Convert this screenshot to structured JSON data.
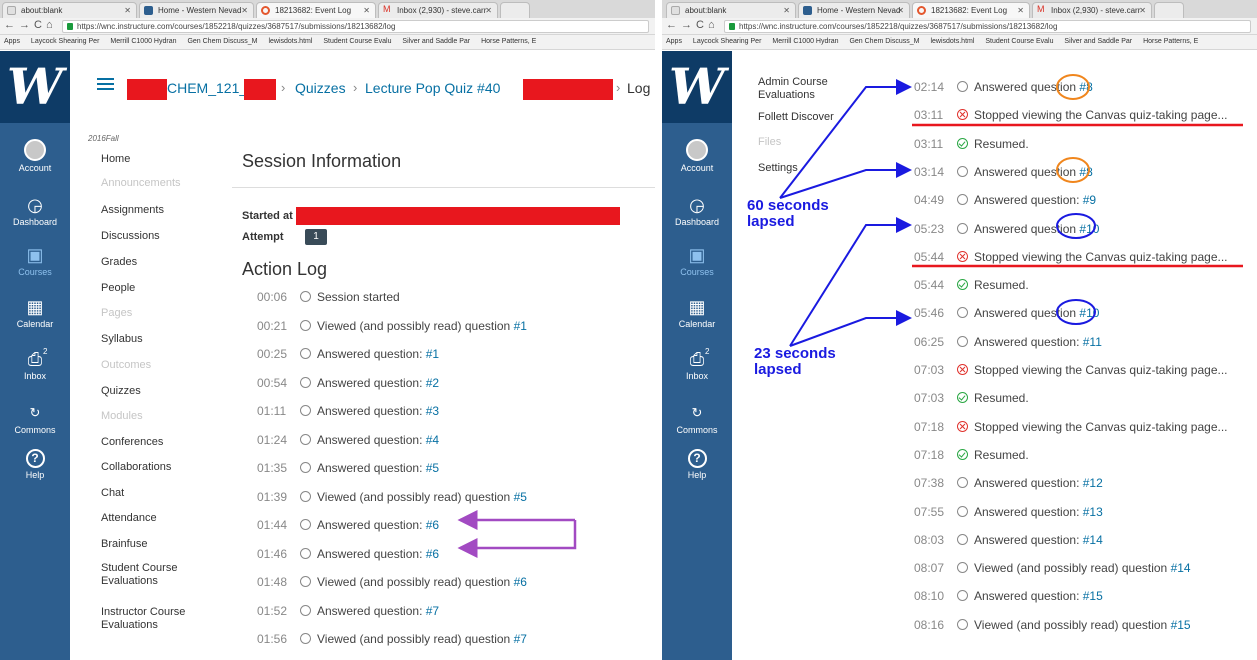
{
  "left": {
    "tabs": [
      {
        "label": "about:blank",
        "color": "#e0e0e0"
      },
      {
        "label": "Home - Western Nevad",
        "color": "#2d5e8e"
      },
      {
        "label": "18213682: Event Log",
        "color": "#e4572e"
      },
      {
        "label": "Inbox (2,930) - steve.carr",
        "color": "#d93025"
      }
    ],
    "url": "https://wnc.instructure.com/courses/1852218/quizzes/3687517/submissions/18213682/log",
    "bookmarks": [
      "Apps",
      "Laycock Shearing Per",
      "Merrill C1000 Hydran",
      "Gen Chem Discuss_M",
      "lewisdots.html",
      "Student Course Evalu",
      "Silver and Saddle Par",
      "Horse Patterns, E"
    ],
    "breadcrumb": {
      "course": "CHEM_121_",
      "quizzes": "Quizzes",
      "quiz": "Lecture Pop Quiz #40",
      "log": "Log",
      "sep": "›"
    },
    "term": "2016Fall",
    "course_nav": [
      {
        "label": "Home",
        "disabled": false
      },
      {
        "label": "Announcements",
        "disabled": true
      },
      {
        "label": "Assignments",
        "disabled": false
      },
      {
        "label": "Discussions",
        "disabled": false
      },
      {
        "label": "Grades",
        "disabled": false
      },
      {
        "label": "People",
        "disabled": false
      },
      {
        "label": "Pages",
        "disabled": true
      },
      {
        "label": "Syllabus",
        "disabled": false
      },
      {
        "label": "Outcomes",
        "disabled": true
      },
      {
        "label": "Quizzes",
        "disabled": false
      },
      {
        "label": "Modules",
        "disabled": true
      },
      {
        "label": "Conferences",
        "disabled": false
      },
      {
        "label": "Collaborations",
        "disabled": false
      },
      {
        "label": "Chat",
        "disabled": false
      },
      {
        "label": "Attendance",
        "disabled": false
      },
      {
        "label": "Brainfuse",
        "disabled": false
      },
      {
        "label": "Student Course\nEvaluations",
        "disabled": false
      },
      {
        "label": "Instructor Course\nEvaluations",
        "disabled": false
      }
    ],
    "session_title": "Session Information",
    "started_label": "Started at",
    "attempt_label": "Attempt",
    "attempt_value": "1",
    "action_log_title": "Action Log",
    "log": [
      {
        "time": "00:06",
        "status": "plain",
        "text": "Session started",
        "q": ""
      },
      {
        "time": "00:21",
        "status": "plain",
        "text": "Viewed (and possibly read) question ",
        "q": "#1"
      },
      {
        "time": "00:25",
        "status": "plain",
        "text": "Answered question: ",
        "q": "#1"
      },
      {
        "time": "00:54",
        "status": "plain",
        "text": "Answered question: ",
        "q": "#2"
      },
      {
        "time": "01:11",
        "status": "plain",
        "text": "Answered question: ",
        "q": "#3"
      },
      {
        "time": "01:24",
        "status": "plain",
        "text": "Answered question: ",
        "q": "#4"
      },
      {
        "time": "01:35",
        "status": "plain",
        "text": "Answered question: ",
        "q": "#5"
      },
      {
        "time": "01:39",
        "status": "plain",
        "text": "Viewed (and possibly read) question ",
        "q": "#5"
      },
      {
        "time": "01:44",
        "status": "plain",
        "text": "Answered question: ",
        "q": "#6"
      },
      {
        "time": "01:46",
        "status": "plain",
        "text": "Answered question: ",
        "q": "#6"
      },
      {
        "time": "01:48",
        "status": "plain",
        "text": "Viewed (and possibly read) question ",
        "q": "#6"
      },
      {
        "time": "01:52",
        "status": "plain",
        "text": "Answered question: ",
        "q": "#7"
      },
      {
        "time": "01:56",
        "status": "plain",
        "text": "Viewed (and possibly read) question ",
        "q": "#7"
      }
    ]
  },
  "right": {
    "tabs": [
      {
        "label": "about:blank",
        "color": "#e0e0e0"
      },
      {
        "label": "Home - Western Nevad",
        "color": "#2d5e8e"
      },
      {
        "label": "18213682: Event Log",
        "color": "#e4572e"
      },
      {
        "label": "Inbox (2,930) - steve.carr",
        "color": "#d93025"
      }
    ],
    "url": "https://wnc.instructure.com/courses/1852218/quizzes/3687517/submissions/18213682/log",
    "bookmarks": [
      "Apps",
      "Laycock Shearing Per",
      "Merrill C1000 Hydran",
      "Gen Chem Discuss_M",
      "lewisdots.html",
      "Student Course Evalu",
      "Silver and Saddle Par",
      "Horse Patterns, E"
    ],
    "course_nav": [
      {
        "label": "Admin Course\nEvaluations",
        "disabled": false
      },
      {
        "label": "Follett Discover",
        "disabled": false
      },
      {
        "label": "Files",
        "disabled": true
      },
      {
        "label": "Settings",
        "disabled": false
      }
    ],
    "annotations": {
      "first": "60 seconds\nlapsed",
      "second": "23 seconds\nlapsed"
    },
    "log": [
      {
        "time": "02:14",
        "status": "plain",
        "text": "Answered question ",
        "q": "#8"
      },
      {
        "time": "03:11",
        "status": "stop",
        "text": "Stopped viewing the Canvas quiz-taking page...",
        "q": ""
      },
      {
        "time": "03:11",
        "status": "ok",
        "text": "Resumed.",
        "q": ""
      },
      {
        "time": "03:14",
        "status": "plain",
        "text": "Answered question ",
        "q": "#8"
      },
      {
        "time": "04:49",
        "status": "plain",
        "text": "Answered question: ",
        "q": "#9"
      },
      {
        "time": "05:23",
        "status": "plain",
        "text": "Answered question ",
        "q": "#10"
      },
      {
        "time": "05:44",
        "status": "stop",
        "text": "Stopped viewing the Canvas quiz-taking page...",
        "q": ""
      },
      {
        "time": "05:44",
        "status": "ok",
        "text": "Resumed.",
        "q": ""
      },
      {
        "time": "05:46",
        "status": "plain",
        "text": "Answered question ",
        "q": "#10"
      },
      {
        "time": "06:25",
        "status": "plain",
        "text": "Answered question: ",
        "q": "#11"
      },
      {
        "time": "07:03",
        "status": "stop",
        "text": "Stopped viewing the Canvas quiz-taking page...",
        "q": ""
      },
      {
        "time": "07:03",
        "status": "ok",
        "text": "Resumed.",
        "q": ""
      },
      {
        "time": "07:18",
        "status": "stop",
        "text": "Stopped viewing the Canvas quiz-taking page...",
        "q": ""
      },
      {
        "time": "07:18",
        "status": "ok",
        "text": "Resumed.",
        "q": ""
      },
      {
        "time": "07:38",
        "status": "plain",
        "text": "Answered question: ",
        "q": "#12"
      },
      {
        "time": "07:55",
        "status": "plain",
        "text": "Answered question: ",
        "q": "#13"
      },
      {
        "time": "08:03",
        "status": "plain",
        "text": "Answered question: ",
        "q": "#14"
      },
      {
        "time": "08:07",
        "status": "plain",
        "text": "Viewed (and possibly read) question ",
        "q": "#14"
      },
      {
        "time": "08:10",
        "status": "plain",
        "text": "Answered question: ",
        "q": "#15"
      },
      {
        "time": "08:16",
        "status": "plain",
        "text": "Viewed (and possibly read) question ",
        "q": "#15"
      }
    ]
  },
  "global_nav": [
    {
      "label": "Account",
      "icon": "account-icon"
    },
    {
      "label": "Dashboard",
      "icon": "dashboard-icon"
    },
    {
      "label": "Courses",
      "icon": "courses-icon",
      "selected": true
    },
    {
      "label": "Calendar",
      "icon": "calendar-icon"
    },
    {
      "label": "Inbox",
      "icon": "inbox-icon",
      "badge": "2"
    },
    {
      "label": "Commons",
      "icon": "commons-icon"
    },
    {
      "label": "Help",
      "icon": "help-icon"
    }
  ],
  "colors": {
    "canvas_nav": "#2d5e8e",
    "canvas_logo_bg": "#0e3b66",
    "link": "#0770a3",
    "redact": "#e8171e",
    "annotation_blue": "#1a1ae0",
    "annotation_orange": "#f0861d",
    "annotation_purple": "#a24ac2"
  }
}
